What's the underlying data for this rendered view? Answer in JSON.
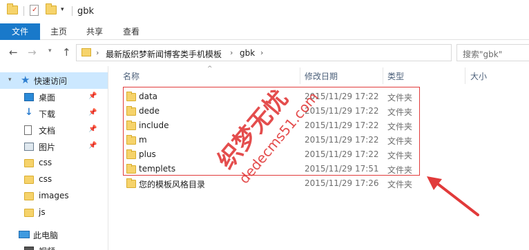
{
  "title": "gbk",
  "ribbon": {
    "tabs": [
      "文件",
      "主页",
      "共享",
      "查看"
    ]
  },
  "address": {
    "breadcrumb": [
      "最新版织梦新闻博客类手机模板",
      "gbk"
    ],
    "search_placeholder": "搜索\"gbk\""
  },
  "sidebar": {
    "quick_access": "快速访问",
    "items": [
      {
        "label": "桌面",
        "icon": "desktop-icon",
        "pinned": true
      },
      {
        "label": "下载",
        "icon": "download-icon",
        "pinned": true
      },
      {
        "label": "文档",
        "icon": "document-icon",
        "pinned": true
      },
      {
        "label": "图片",
        "icon": "picture-icon",
        "pinned": true
      },
      {
        "label": "css",
        "icon": "folder-icon",
        "pinned": false
      },
      {
        "label": "css",
        "icon": "folder-icon",
        "pinned": false
      },
      {
        "label": "images",
        "icon": "folder-icon",
        "pinned": false
      },
      {
        "label": "js",
        "icon": "folder-icon",
        "pinned": false
      }
    ],
    "this_pc": "此电脑",
    "videos": "视频"
  },
  "columns": {
    "name": "名称",
    "date": "修改日期",
    "type": "类型",
    "size": "大小"
  },
  "files": [
    {
      "name": "data",
      "date": "2015/11/29 17:22",
      "type": "文件夹"
    },
    {
      "name": "dede",
      "date": "2015/11/29 17:22",
      "type": "文件夹"
    },
    {
      "name": "include",
      "date": "2015/11/29 17:22",
      "type": "文件夹"
    },
    {
      "name": "m",
      "date": "2015/11/29 17:22",
      "type": "文件夹"
    },
    {
      "name": "plus",
      "date": "2015/11/29 17:22",
      "type": "文件夹"
    },
    {
      "name": "templets",
      "date": "2015/11/29 17:51",
      "type": "文件夹"
    },
    {
      "name": "您的模板风格目录",
      "date": "2015/11/29 17:26",
      "type": "文件夹"
    }
  ],
  "watermark": {
    "cn": "织梦无忧",
    "url": "dedecms51.com"
  },
  "colors": {
    "accent": "#1979ca",
    "selection": "#cce8ff",
    "annotation": "#e13a3a"
  }
}
